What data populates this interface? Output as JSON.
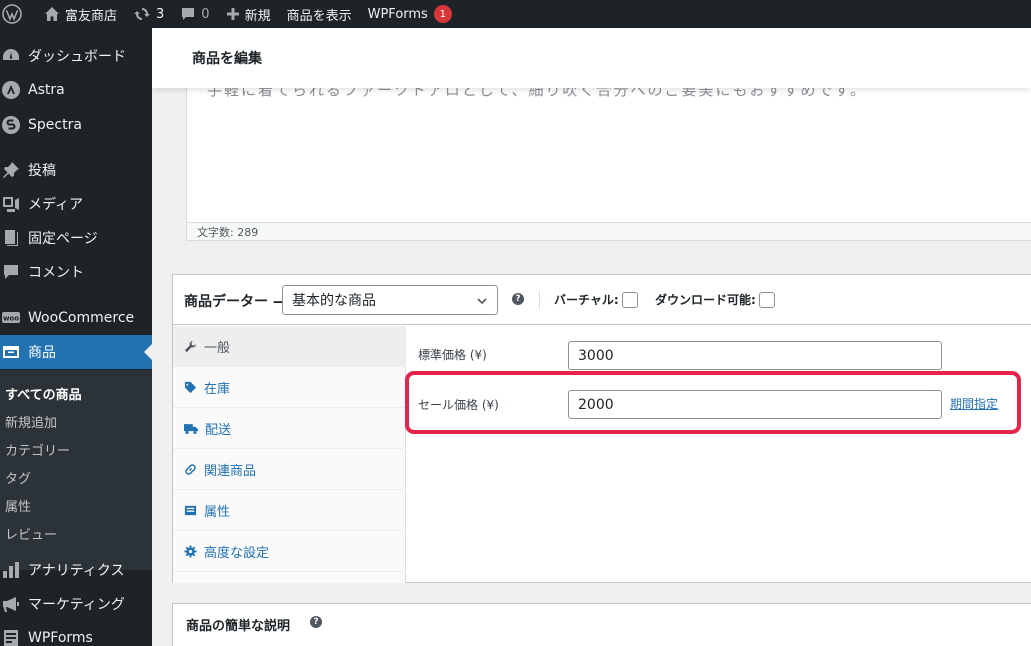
{
  "admin_bar": {
    "site_name": "富友商店",
    "updates_count": "3",
    "comments_count": "0",
    "new_label": "新規",
    "view_product_label": "商品を表示",
    "wpforms_label": "WPForms",
    "wpforms_badge": "1"
  },
  "sidebar": {
    "items": [
      {
        "label": "ダッシュボード",
        "icon": "dashboard-icon"
      },
      {
        "label": "Astra",
        "icon": "astra-icon"
      },
      {
        "label": "Spectra",
        "icon": "spectra-icon"
      },
      {
        "label": "投稿",
        "icon": "pin-icon"
      },
      {
        "label": "メディア",
        "icon": "media-icon"
      },
      {
        "label": "固定ページ",
        "icon": "page-icon"
      },
      {
        "label": "コメント",
        "icon": "comment-icon"
      },
      {
        "label": "WooCommerce",
        "icon": "woo-icon"
      },
      {
        "label": "商品",
        "icon": "archive-icon"
      },
      {
        "label": "アナリティクス",
        "icon": "bar-chart-icon"
      },
      {
        "label": "マーケティング",
        "icon": "megaphone-icon"
      },
      {
        "label": "WPForms",
        "icon": "forms-icon"
      }
    ],
    "submenu": [
      "すべての商品",
      "新規追加",
      "カテゴリー",
      "タグ",
      "属性",
      "レビュー"
    ]
  },
  "header": {
    "title": "商品を編集"
  },
  "editor": {
    "ghost_text": "手軽に着てられるファーツトアロとして、細り吹く合分へのご要美にもおすすめです。",
    "word_count": "文字数: 289"
  },
  "product_data": {
    "title": "商品データー —",
    "type_value": "基本的な商品",
    "virtual_label": "バーチャル:",
    "download_label": "ダウンロード可能:",
    "tabs": [
      {
        "label": "一般",
        "icon": "wrench-icon"
      },
      {
        "label": "在庫",
        "icon": "tag-icon"
      },
      {
        "label": "配送",
        "icon": "truck-icon"
      },
      {
        "label": "関連商品",
        "icon": "link-icon"
      },
      {
        "label": "属性",
        "icon": "list-icon"
      },
      {
        "label": "高度な設定",
        "icon": "gear-icon"
      }
    ],
    "regular_price_label": "標準価格 (¥)",
    "regular_price_value": "3000",
    "sale_price_label": "セール価格 (¥)",
    "sale_price_value": "2000",
    "schedule_link": "期間指定"
  },
  "short_description": {
    "title": "商品の簡単な説明"
  },
  "colors": {
    "admin_dark": "#1d2327",
    "accent_blue": "#2271b1",
    "highlight_red": "#e5234b"
  }
}
